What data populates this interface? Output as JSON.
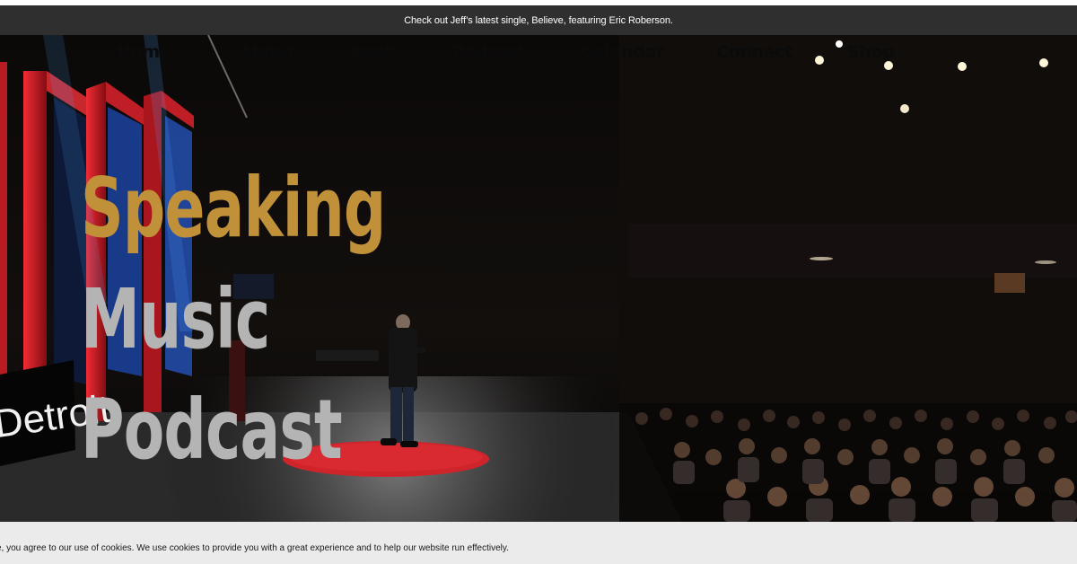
{
  "announcement": {
    "text": "Check out Jeff’s latest single, Believe, featuring Eric Roberson."
  },
  "nav": {
    "items": [
      {
        "label": "Home"
      },
      {
        "label": "About"
      },
      {
        "label": "Book"
      },
      {
        "label": "Podcast"
      },
      {
        "label": "Calendar"
      },
      {
        "label": "Connect"
      },
      {
        "label": "Shop"
      }
    ]
  },
  "hero": {
    "stage_sign": "Detroit",
    "headline": {
      "line1": "Speaking",
      "line2": "Music",
      "line3": "Podcast"
    }
  },
  "cookie_notice": {
    "text": "e, you agree to our use of cookies. We use cookies to provide you with a great experience and to help our website run effectively."
  },
  "colors": {
    "announcement_bg": "#2f2f2f",
    "headline_gold": "#c1913a",
    "headline_grey": "#b4b4b4",
    "stage_red": "#c8222b",
    "cookie_bg": "#ebebeb"
  }
}
